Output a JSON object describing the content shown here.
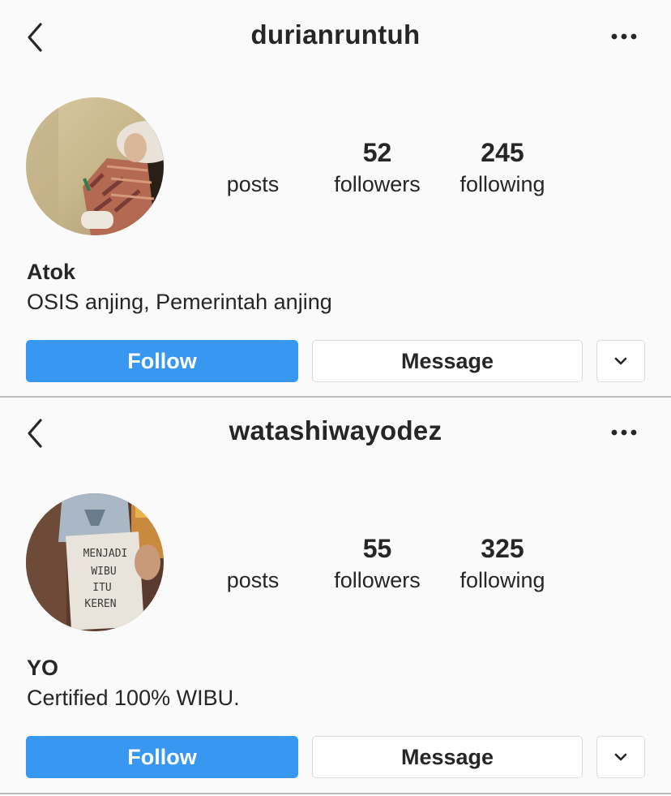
{
  "profiles": [
    {
      "username": "durianruntuh",
      "stats": {
        "posts_value": "",
        "posts_label": "posts",
        "followers_value": "52",
        "followers_label": "followers",
        "following_value": "245",
        "following_label": "following"
      },
      "full_name": "Atok",
      "bio": "OSIS anjing, Pemerintah anjing",
      "follow_label": "Follow",
      "message_label": "Message"
    },
    {
      "username": "watashiwayodez",
      "stats": {
        "posts_value": "",
        "posts_label": "posts",
        "followers_value": "55",
        "followers_label": "followers",
        "following_value": "325",
        "following_label": "following"
      },
      "full_name": "YO",
      "bio": "Certified 100% WIBU.",
      "follow_label": "Follow",
      "message_label": "Message",
      "avatar_sign_text": [
        "MENJADI",
        "WIBU",
        "ITU",
        "KEREN"
      ]
    }
  ],
  "colors": {
    "follow_button": "#3897f0",
    "background": "#fafafa",
    "text": "#262626",
    "border": "#dbdbdb"
  },
  "icons": {
    "back": "chevron-left-icon",
    "more": "more-horizontal-icon",
    "dropdown": "chevron-down-icon"
  }
}
